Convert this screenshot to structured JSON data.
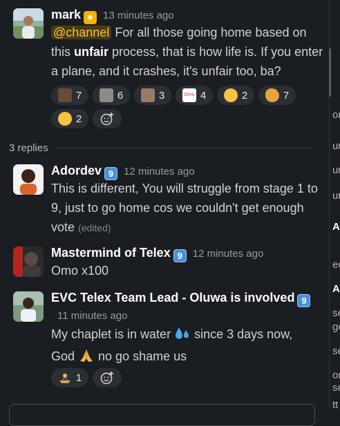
{
  "messages": [
    {
      "author": "mark",
      "status_emoji": "✷",
      "time": "13 minutes ago",
      "mention": "@channel",
      "text_parts": [
        " For all those going home based on this ",
        "unfair",
        " process, that is how life is. If you enter a plane, and it crashes, it's unfair too, ba?"
      ],
      "reactions": [
        {
          "icon": "avatar-icon-1",
          "count": "7"
        },
        {
          "icon": "avatar-icon-2",
          "count": "6"
        },
        {
          "icon": "avatar-icon-3",
          "count": "3"
        },
        {
          "icon": "omo-icon",
          "count": "4"
        },
        {
          "icon": "relieved-face-icon",
          "count": "2"
        },
        {
          "icon": "clapping-hands-icon",
          "count": "7"
        },
        {
          "icon": "sleeping-face-icon",
          "count": "2"
        }
      ]
    },
    {
      "author": "Adordev",
      "status_badge": "9",
      "time": "12 minutes ago",
      "text": "This is different, You will struggle from stage 1 to 9, just to go home cos we couldn't get enough vote",
      "edited": "(edited)"
    },
    {
      "author": "Mastermind of Telex",
      "status_badge": "9",
      "time": "12 minutes ago",
      "text": "Omo x100"
    },
    {
      "author": "EVC Telex Team Lead - Oluwa is involved",
      "status_badge": "9",
      "time": "11 minutes ago",
      "text_a": "My chaplet is in water ",
      "text_b": " since 3 days now,",
      "text_c": "God ",
      "text_d": " no go shame us",
      "reactions": [
        {
          "icon": "person-in-boat-icon",
          "count": "1"
        }
      ]
    }
  ],
  "replies_label": "3 replies",
  "omo_label": "Omo",
  "sidebar_fragments": [
    "or",
    "ur",
    "ur",
    "ur",
    "Al",
    "ed",
    "Al",
    "se",
    "ge",
    "se",
    "or",
    "se",
    "tt"
  ],
  "colors": {
    "background": "#1a1d21",
    "mention_bg": "#4a3b12",
    "mention_fg": "#f2c744",
    "badge_blue": "#4a90d9"
  }
}
